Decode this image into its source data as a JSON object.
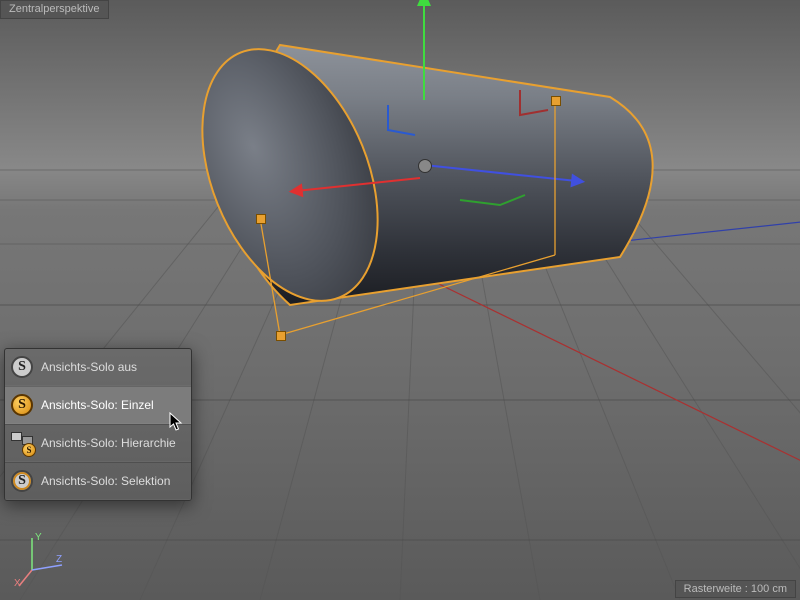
{
  "viewport": {
    "label": "Zentralperspektive",
    "grid_size_label": "Rasterweite : 100 cm"
  },
  "menu": {
    "items": [
      {
        "label": "Ansichts-Solo aus"
      },
      {
        "label": "Ansichts-Solo: Einzel"
      },
      {
        "label": "Ansichts-Solo: Hierarchie"
      },
      {
        "label": "Ansichts-Solo: Selektion"
      }
    ],
    "highlighted_index": 1
  },
  "mini_axis": {
    "x": "X",
    "y": "Y",
    "z": "Z"
  },
  "colors": {
    "accent_orange": "#e8a030",
    "axis_x": "#dd3a3a",
    "axis_y": "#3fdc3f",
    "axis_z": "#4050e0"
  }
}
